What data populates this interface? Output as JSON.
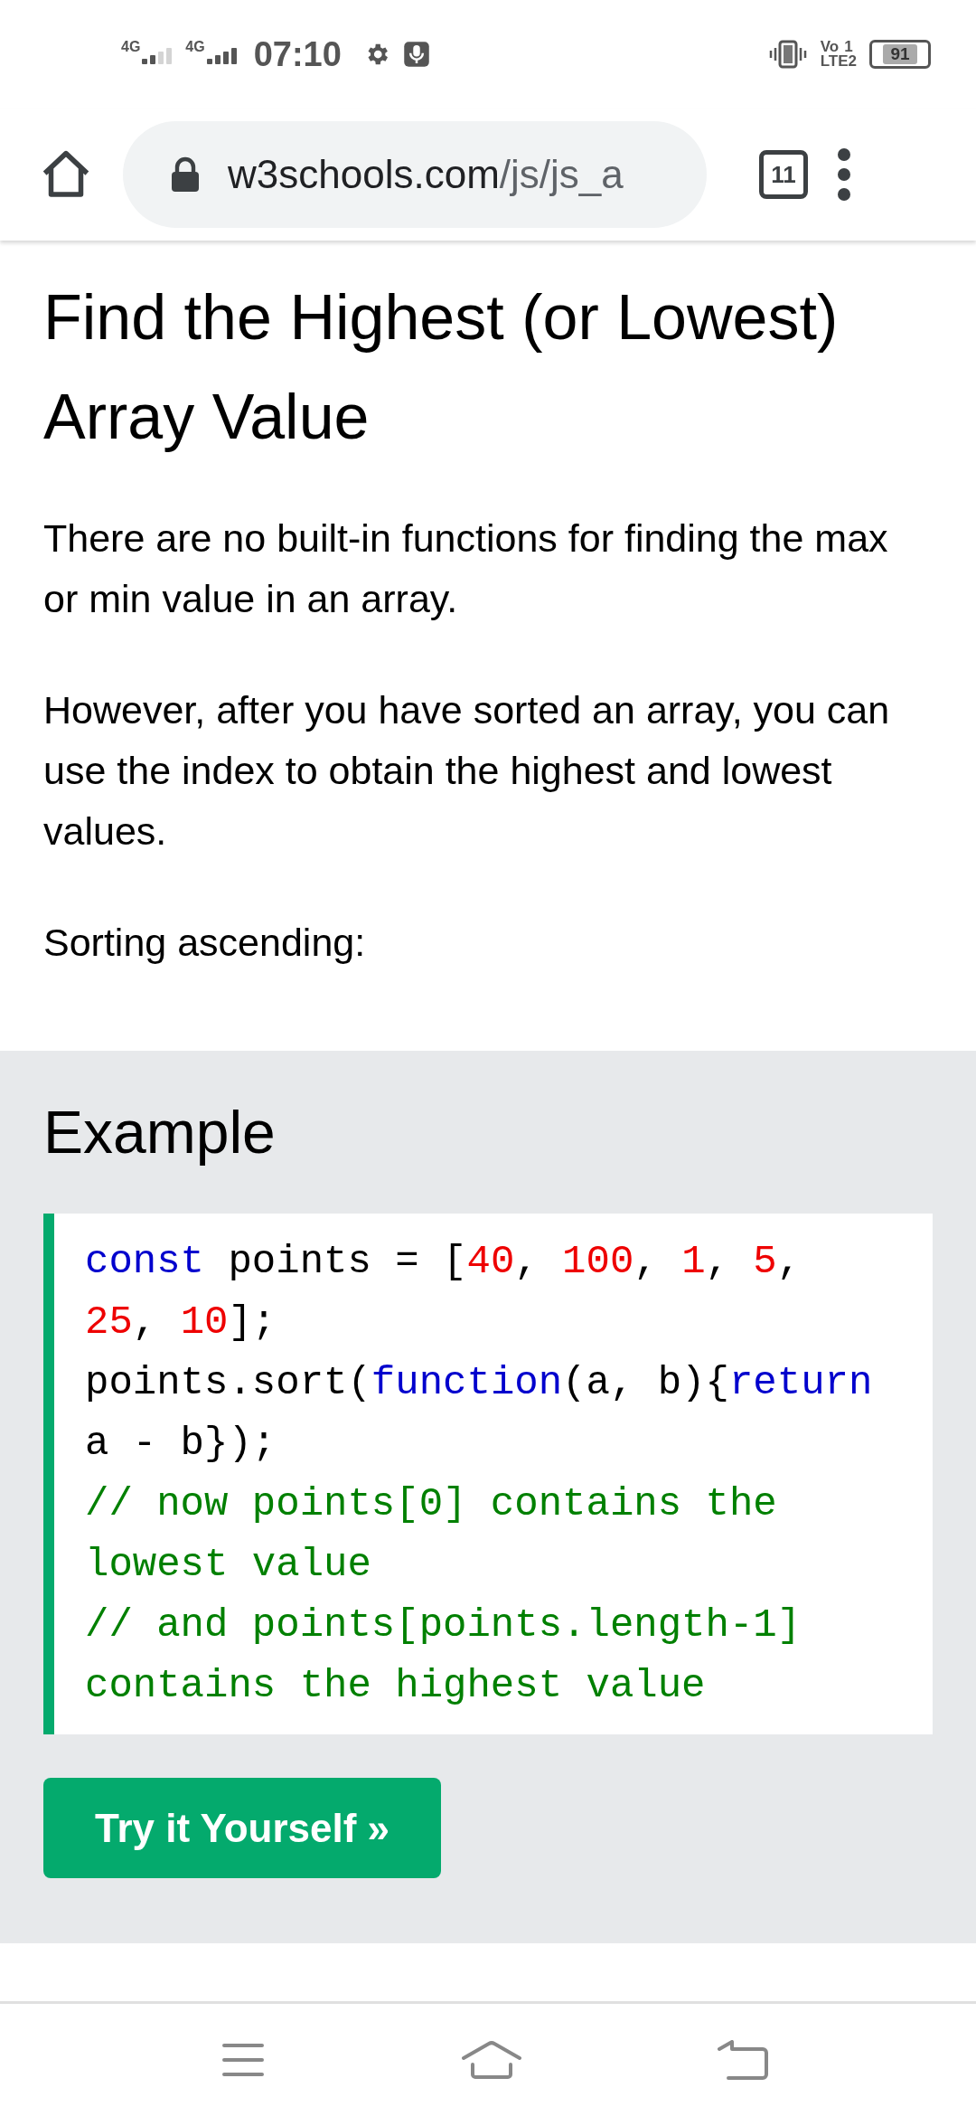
{
  "status_bar": {
    "networks": [
      {
        "label": "4G"
      },
      {
        "label": "4G"
      }
    ],
    "time": "07:10",
    "volte": {
      "top": "Vo",
      "sim": "1",
      "bottom": "LTE2"
    },
    "battery": "91"
  },
  "browser": {
    "url_host": "w3schools.com",
    "url_path": "/js/js_a",
    "tab_count": "11"
  },
  "article": {
    "heading": "Find the Highest (or Lowest) Array Value",
    "paragraphs": [
      "There are no built-in functions for finding the max or min value in an array.",
      "However, after you have sorted an array, you can use the index to obtain the highest and lowest values.",
      "Sorting ascending:"
    ]
  },
  "example": {
    "title": "Example",
    "code_lines": [
      [
        {
          "kind": "keyword",
          "text": "const"
        },
        {
          "kind": "plain",
          "text": " points = ["
        },
        {
          "kind": "number",
          "text": "40"
        },
        {
          "kind": "plain",
          "text": ", "
        },
        {
          "kind": "number",
          "text": "100"
        },
        {
          "kind": "plain",
          "text": ", "
        },
        {
          "kind": "number",
          "text": "1"
        },
        {
          "kind": "plain",
          "text": ", "
        },
        {
          "kind": "number",
          "text": "5"
        },
        {
          "kind": "plain",
          "text": ","
        }
      ],
      [
        {
          "kind": "number",
          "text": "25"
        },
        {
          "kind": "plain",
          "text": ", "
        },
        {
          "kind": "number",
          "text": "10"
        },
        {
          "kind": "plain",
          "text": "];"
        }
      ],
      [
        {
          "kind": "plain",
          "text": "points.sort("
        },
        {
          "kind": "keyword",
          "text": "function"
        },
        {
          "kind": "plain",
          "text": "(a, b){"
        },
        {
          "kind": "keyword",
          "text": "return"
        }
      ],
      [
        {
          "kind": "plain",
          "text": "a - b});"
        }
      ],
      [
        {
          "kind": "comment",
          "text": "// now points[0] contains the"
        }
      ],
      [
        {
          "kind": "comment",
          "text": "lowest value"
        }
      ],
      [
        {
          "kind": "comment",
          "text": "// and points[points.length-1]"
        }
      ],
      [
        {
          "kind": "comment",
          "text": "contains the highest value"
        }
      ]
    ],
    "button": "Try it Yourself »"
  }
}
